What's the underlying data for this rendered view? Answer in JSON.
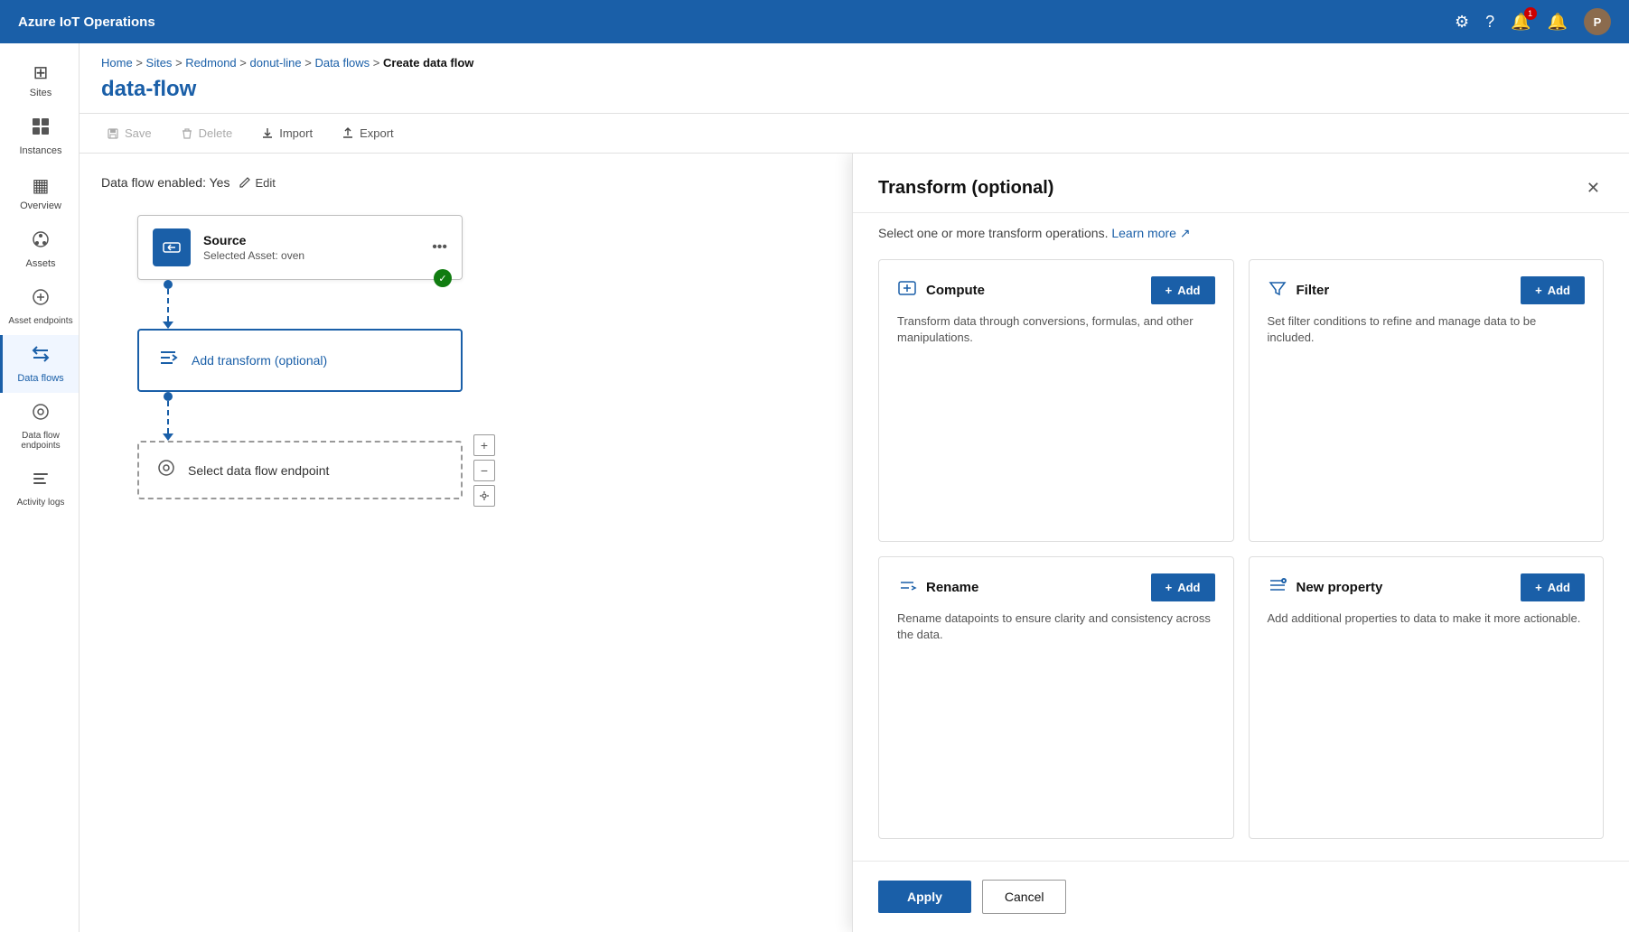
{
  "app": {
    "title": "Azure IoT Operations"
  },
  "topnav": {
    "title": "Azure IoT Operations",
    "avatar_label": "P",
    "notification_count": "1"
  },
  "sidebar": {
    "items": [
      {
        "id": "sites",
        "label": "Sites",
        "icon": "⊞"
      },
      {
        "id": "instances",
        "label": "Instances",
        "icon": "⬛"
      },
      {
        "id": "overview",
        "label": "Overview",
        "icon": "▦"
      },
      {
        "id": "assets",
        "label": "Assets",
        "icon": "✦"
      },
      {
        "id": "asset-endpoints",
        "label": "Asset endpoints",
        "icon": "⬡"
      },
      {
        "id": "data-flows",
        "label": "Data flows",
        "icon": "⇄",
        "active": true
      },
      {
        "id": "data-flow-endpoints",
        "label": "Data flow endpoints",
        "icon": "◎"
      },
      {
        "id": "activity-logs",
        "label": "Activity logs",
        "icon": "≡"
      }
    ]
  },
  "breadcrumb": {
    "items": [
      {
        "label": "Home",
        "link": true
      },
      {
        "label": "Sites",
        "link": true
      },
      {
        "label": "Redmond",
        "link": true
      },
      {
        "label": "donut-line",
        "link": true
      },
      {
        "label": "Data flows",
        "link": true
      },
      {
        "label": "Create data flow",
        "link": false,
        "current": true
      }
    ]
  },
  "page": {
    "title": "data-flow"
  },
  "toolbar": {
    "save_label": "Save",
    "delete_label": "Delete",
    "import_label": "Import",
    "export_label": "Export"
  },
  "flow": {
    "enabled_label": "Data flow enabled: Yes",
    "edit_label": "Edit",
    "source_node": {
      "title": "Source",
      "sub": "Selected Asset: oven",
      "menu_label": "..."
    },
    "transform_node": {
      "label": "Add transform (optional)"
    },
    "endpoint_node": {
      "label": "Select data flow endpoint"
    }
  },
  "panel": {
    "title": "Transform (optional)",
    "subtitle": "Select one or more transform operations.",
    "learn_more_label": "Learn more",
    "close_label": "✕",
    "cards": [
      {
        "id": "compute",
        "name": "Compute",
        "icon": "🔧",
        "description": "Transform data through conversions, formulas, and other manipulations.",
        "add_label": "+ Add"
      },
      {
        "id": "filter",
        "name": "Filter",
        "icon": "⊞",
        "description": "Set filter conditions to refine and manage data to be included.",
        "add_label": "+ Add"
      },
      {
        "id": "rename",
        "name": "Rename",
        "icon": "🔄",
        "description": "Rename datapoints to ensure clarity and consistency across the data.",
        "add_label": "+ Add"
      },
      {
        "id": "new-property",
        "name": "New property",
        "icon": "≡",
        "description": "Add additional properties to data to make it more actionable.",
        "add_label": "+ Add"
      }
    ],
    "apply_label": "Apply",
    "cancel_label": "Cancel"
  }
}
